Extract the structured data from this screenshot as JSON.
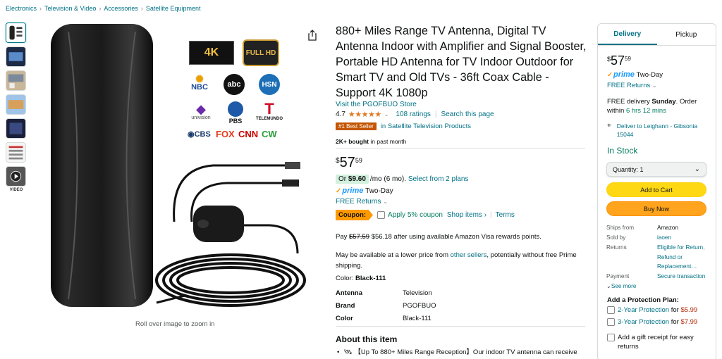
{
  "breadcrumb": [
    "Electronics",
    "Television & Video",
    "Accessories",
    "Satellite Equipment"
  ],
  "gallery": {
    "thumbnails": [
      "thumb-1",
      "thumb-2",
      "thumb-3",
      "thumb-4",
      "thumb-5",
      "thumb-6",
      "thumb-7"
    ],
    "video_label": "VIDEO",
    "zoom_hint": "Roll over image to zoom in",
    "badges": [
      "4K",
      "FULL HD"
    ],
    "channel_logos": [
      "NBC",
      "abc",
      "HSN",
      "univision",
      "PBS",
      "TELEMUNDO",
      "CBS",
      "FOX",
      "CNN",
      "CW"
    ]
  },
  "product": {
    "title": "880+ Miles Range TV Antenna, Digital TV Antenna Indoor with Amplifier and Signal Booster, Portable HD Antenna for TV Indoor Outdoor for Smart TV and Old TVs - 36ft Coax Cable - Support 4K 1080p",
    "store": "Visit the PGOFBUO Store",
    "rating": "4.7",
    "ratings_count": "108 ratings",
    "search_page": "Search this page",
    "best_seller": "#1 Best Seller",
    "category": "in Satellite Television Products",
    "bought_bold": "2K+ bought",
    "bought_rest": "in past month",
    "price_currency": "$",
    "price_whole": "57",
    "price_fraction": "59",
    "or_label": "Or",
    "monthly_amount": "$9.60",
    "monthly_rest": "/mo (6 mo).",
    "plans_link": "Select from 2 plans",
    "prime": "prime",
    "two_day": "Two-Day",
    "free_returns": "FREE Returns",
    "coupon_label": "Coupon:",
    "coupon_text": "Apply 5% coupon",
    "shop_items": "Shop items ›",
    "terms": "Terms",
    "pay_prefix": "Pay",
    "pay_strike": "$57.59",
    "pay_rest": "$56.18 after using available Amazon Visa rewards points.",
    "lower_prefix": "May be available at a lower price from",
    "lower_link": "other sellers",
    "lower_suffix": ", potentially without free Prime shipping.",
    "color_label": "Color:",
    "color_value": "Black-111",
    "specs": [
      {
        "k": "Antenna",
        "v": "Television"
      },
      {
        "k": "Brand",
        "v": "PGOFBUO"
      },
      {
        "k": "Color",
        "v": "Black-111"
      }
    ],
    "about_title": "About this item",
    "bullet_1": "【Up To 880+ Miles Range Reception】Our indoor TV antenna can receive"
  },
  "buybox": {
    "tab_delivery": "Delivery",
    "tab_pickup": "Pickup",
    "price_currency": "$",
    "price_whole": "57",
    "price_fraction": "59",
    "prime": "prime",
    "two_day": "Two-Day",
    "free_returns": "FREE Returns",
    "delivery_pre": "FREE delivery",
    "delivery_day": "Sunday",
    "delivery_mid": ". Order within",
    "delivery_time": "6 hrs 12 mins",
    "location": "Deliver to Leighann - Gibsonia 15044",
    "stock": "In Stock",
    "quantity": "Quantity: 1",
    "add_to_cart": "Add to Cart",
    "buy_now": "Buy Now",
    "ships_from_k": "Ships from",
    "ships_from_v": "Amazon",
    "sold_by_k": "Sold by",
    "sold_by_v": "iaoen",
    "returns_k": "Returns",
    "returns_v": "Eligible for Return, Refund or Replacement…",
    "payment_k": "Payment",
    "payment_v": "Secure transaction",
    "see_more": "See more",
    "protection_title": "Add a Protection Plan:",
    "plan1": "2-Year Protection",
    "plan1_price": "$5.99",
    "plan2": "3-Year Protection",
    "plan2_price": "$7.99",
    "for": "for",
    "gift": "Add a gift receipt for easy returns"
  }
}
